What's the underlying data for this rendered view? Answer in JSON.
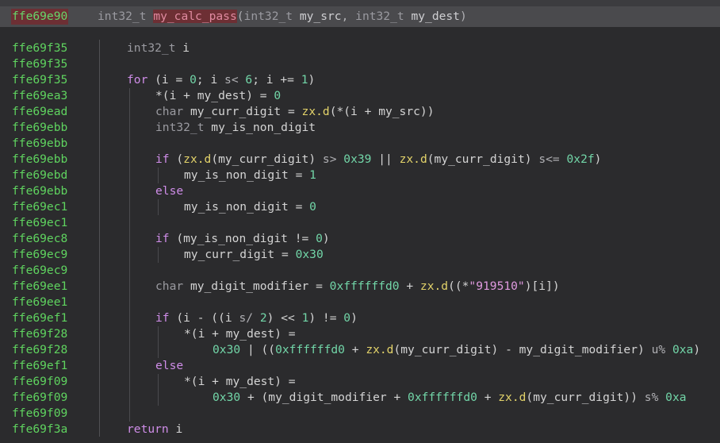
{
  "header": {
    "address": "ffe69e90",
    "return_type": "int32_t",
    "function_name": "my_calc_pass",
    "params": [
      {
        "type": "int32_t",
        "name": "my_src"
      },
      {
        "type": "int32_t",
        "name": "my_dest"
      }
    ]
  },
  "lines": [
    {
      "addr": "ffe69f35",
      "indent": 0,
      "tokens": [
        [
          "ty",
          "int32_t"
        ],
        [
          "var",
          " i"
        ]
      ]
    },
    {
      "addr": "ffe69f35",
      "indent": 0,
      "tokens": []
    },
    {
      "addr": "ffe69f35",
      "indent": 0,
      "tokens": [
        [
          "kw",
          "for"
        ],
        [
          "var",
          " (i = "
        ],
        [
          "num",
          "0"
        ],
        [
          "var",
          "; i "
        ],
        [
          "op",
          "s<"
        ],
        [
          "var",
          " "
        ],
        [
          "num",
          "6"
        ],
        [
          "var",
          "; i += "
        ],
        [
          "num",
          "1"
        ],
        [
          "var",
          ")"
        ]
      ]
    },
    {
      "addr": "ffe69ea3",
      "indent": 1,
      "tokens": [
        [
          "var",
          "*(i + my_dest) = "
        ],
        [
          "num",
          "0"
        ]
      ]
    },
    {
      "addr": "ffe69ead",
      "indent": 1,
      "tokens": [
        [
          "ty",
          "char"
        ],
        [
          "var",
          " my_curr_digit = "
        ],
        [
          "fn",
          "zx.d"
        ],
        [
          "var",
          "(*(i + my_src))"
        ]
      ]
    },
    {
      "addr": "ffe69ebb",
      "indent": 1,
      "tokens": [
        [
          "ty",
          "int32_t"
        ],
        [
          "var",
          " my_is_non_digit"
        ]
      ]
    },
    {
      "addr": "ffe69ebb",
      "indent": 1,
      "tokens": []
    },
    {
      "addr": "ffe69ebb",
      "indent": 1,
      "tokens": [
        [
          "kw",
          "if"
        ],
        [
          "var",
          " ("
        ],
        [
          "fn",
          "zx.d"
        ],
        [
          "var",
          "(my_curr_digit) "
        ],
        [
          "op",
          "s>"
        ],
        [
          "var",
          " "
        ],
        [
          "num",
          "0x39"
        ],
        [
          "var",
          " || "
        ],
        [
          "fn",
          "zx.d"
        ],
        [
          "var",
          "(my_curr_digit) "
        ],
        [
          "op",
          "s<="
        ],
        [
          "var",
          " "
        ],
        [
          "num",
          "0x2f"
        ],
        [
          "var",
          ")"
        ]
      ]
    },
    {
      "addr": "ffe69ebd",
      "indent": 2,
      "tokens": [
        [
          "var",
          "my_is_non_digit = "
        ],
        [
          "num",
          "1"
        ]
      ]
    },
    {
      "addr": "ffe69ebb",
      "indent": 1,
      "tokens": [
        [
          "kw",
          "else"
        ]
      ]
    },
    {
      "addr": "ffe69ec1",
      "indent": 2,
      "tokens": [
        [
          "var",
          "my_is_non_digit = "
        ],
        [
          "num",
          "0"
        ]
      ]
    },
    {
      "addr": "ffe69ec1",
      "indent": 1,
      "tokens": []
    },
    {
      "addr": "ffe69ec8",
      "indent": 1,
      "tokens": [
        [
          "kw",
          "if"
        ],
        [
          "var",
          " (my_is_non_digit != "
        ],
        [
          "num",
          "0"
        ],
        [
          "var",
          ")"
        ]
      ]
    },
    {
      "addr": "ffe69ec9",
      "indent": 2,
      "tokens": [
        [
          "var",
          "my_curr_digit = "
        ],
        [
          "num",
          "0x30"
        ]
      ]
    },
    {
      "addr": "ffe69ec9",
      "indent": 1,
      "tokens": []
    },
    {
      "addr": "ffe69ee1",
      "indent": 1,
      "tokens": [
        [
          "ty",
          "char"
        ],
        [
          "var",
          " my_digit_modifier = "
        ],
        [
          "num",
          "0xffffffd0"
        ],
        [
          "var",
          " + "
        ],
        [
          "fn",
          "zx.d"
        ],
        [
          "var",
          "((*"
        ],
        [
          "str",
          "\"919510\""
        ],
        [
          "var",
          ")[i])"
        ]
      ]
    },
    {
      "addr": "ffe69ee1",
      "indent": 1,
      "tokens": []
    },
    {
      "addr": "ffe69ef1",
      "indent": 1,
      "tokens": [
        [
          "kw",
          "if"
        ],
        [
          "var",
          " (i - ((i "
        ],
        [
          "op",
          "s/"
        ],
        [
          "var",
          " "
        ],
        [
          "num",
          "2"
        ],
        [
          "var",
          ") << "
        ],
        [
          "num",
          "1"
        ],
        [
          "var",
          ") != "
        ],
        [
          "num",
          "0"
        ],
        [
          "var",
          ")"
        ]
      ]
    },
    {
      "addr": "ffe69f28",
      "indent": 2,
      "tokens": [
        [
          "var",
          "*(i + my_dest) ="
        ]
      ]
    },
    {
      "addr": "ffe69f28",
      "indent": 3,
      "tokens": [
        [
          "num",
          "0x30"
        ],
        [
          "var",
          " | (("
        ],
        [
          "num",
          "0xffffffd0"
        ],
        [
          "var",
          " + "
        ],
        [
          "fn",
          "zx.d"
        ],
        [
          "var",
          "(my_curr_digit) - my_digit_modifier) "
        ],
        [
          "op",
          "u%"
        ],
        [
          "var",
          " "
        ],
        [
          "num",
          "0xa"
        ],
        [
          "var",
          ")"
        ]
      ]
    },
    {
      "addr": "ffe69ef1",
      "indent": 1,
      "tokens": [
        [
          "kw",
          "else"
        ]
      ]
    },
    {
      "addr": "ffe69f09",
      "indent": 2,
      "tokens": [
        [
          "var",
          "*(i + my_dest) ="
        ]
      ]
    },
    {
      "addr": "ffe69f09",
      "indent": 3,
      "tokens": [
        [
          "num",
          "0x30"
        ],
        [
          "var",
          " + (my_digit_modifier + "
        ],
        [
          "num",
          "0xffffffd0"
        ],
        [
          "var",
          " + "
        ],
        [
          "fn",
          "zx.d"
        ],
        [
          "var",
          "(my_curr_digit)) "
        ],
        [
          "op",
          "s%"
        ],
        [
          "var",
          " "
        ],
        [
          "num",
          "0xa"
        ]
      ]
    },
    {
      "addr": "ffe69f09",
      "indent": 1,
      "tokens": []
    },
    {
      "addr": "ffe69f3a",
      "indent": 0,
      "tokens": [
        [
          "kw",
          "return"
        ],
        [
          "var",
          " i"
        ]
      ]
    }
  ]
}
